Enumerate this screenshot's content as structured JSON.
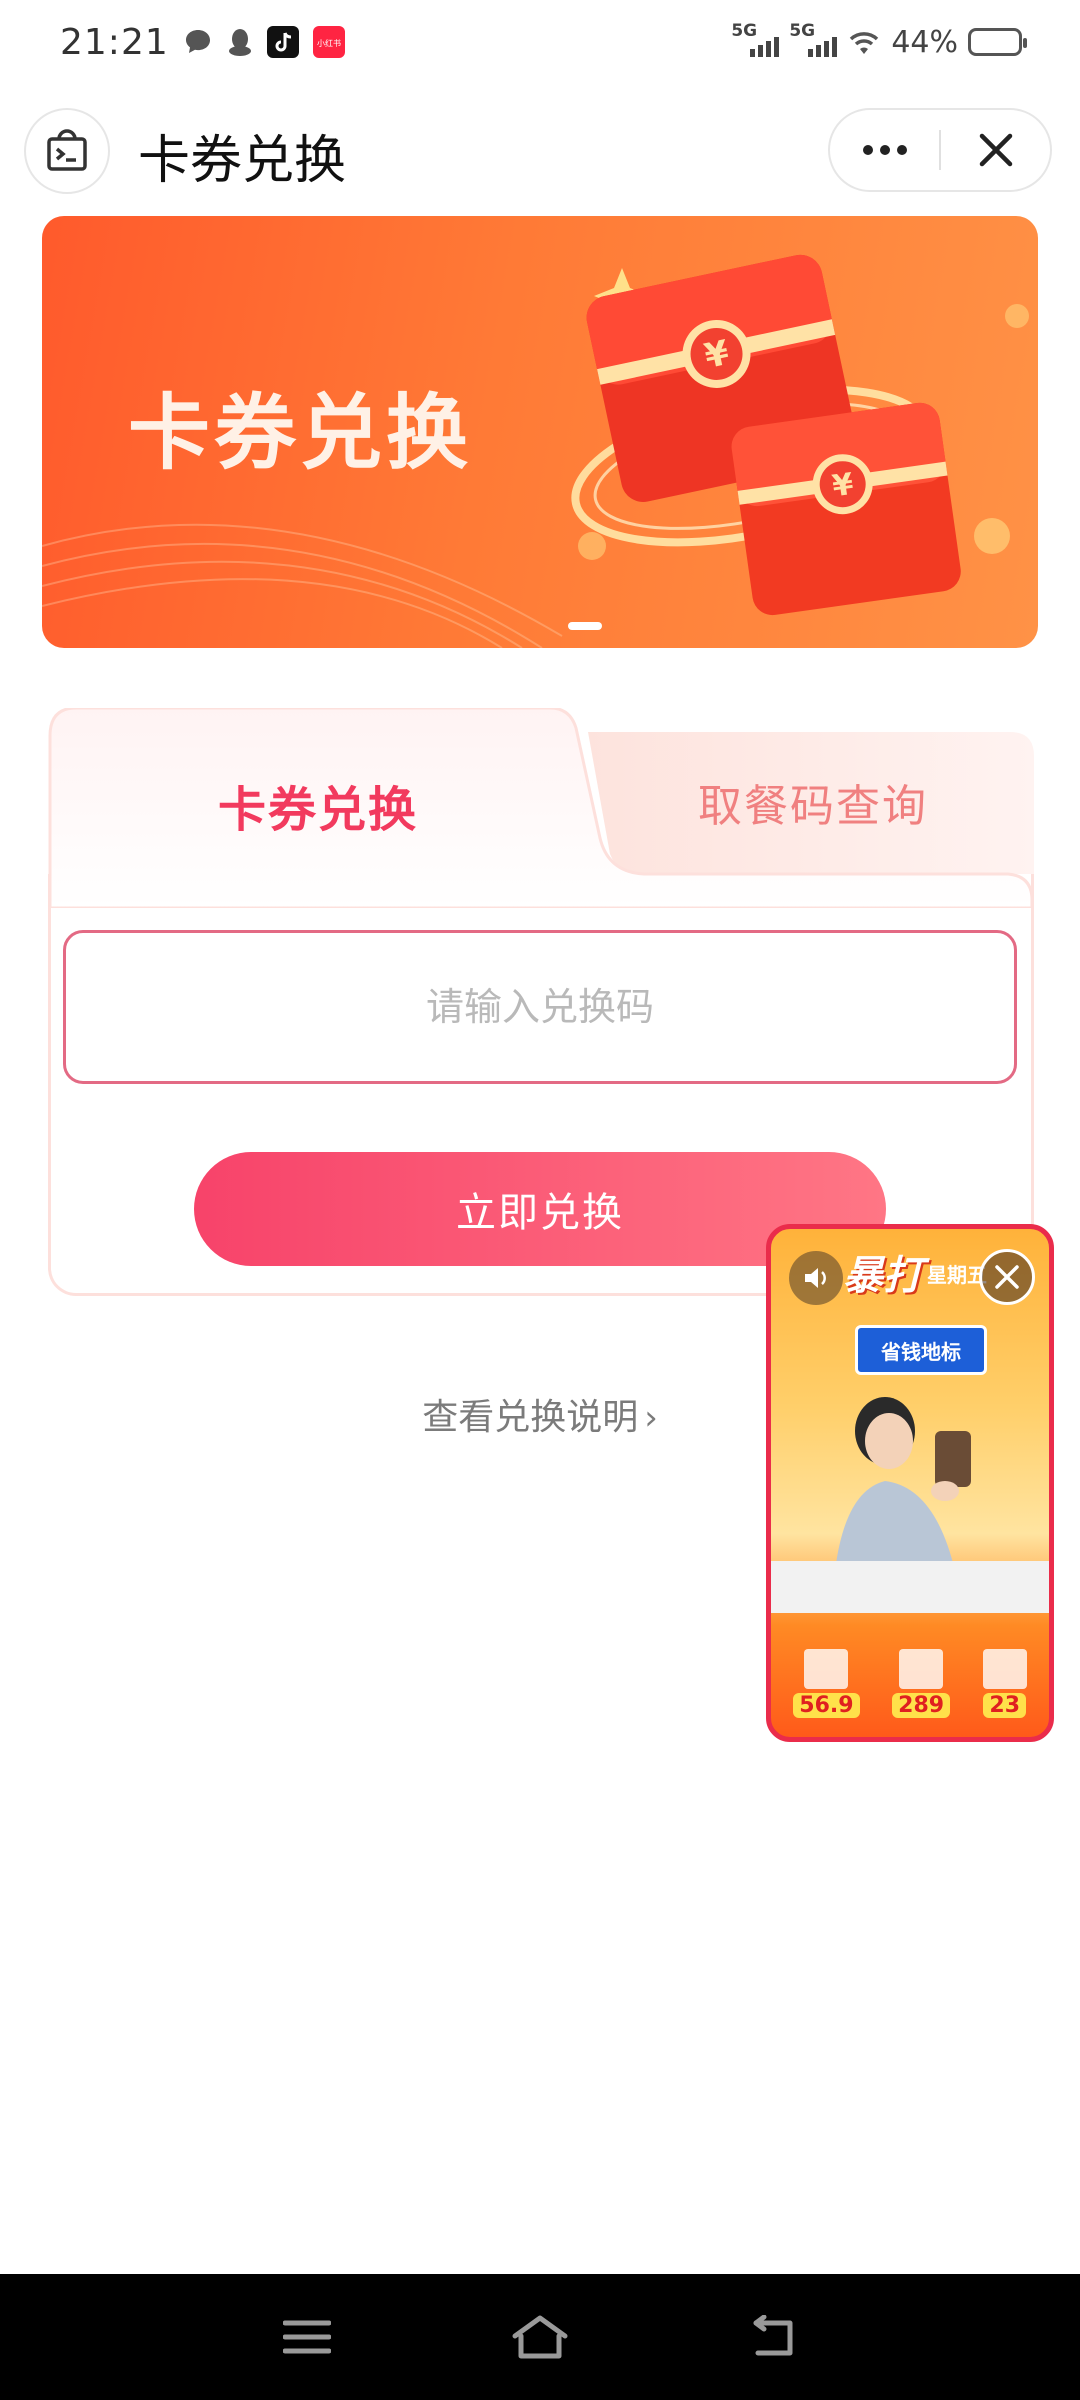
{
  "status_bar": {
    "time": "21:21",
    "network1": "5G",
    "network2": "5G",
    "battery": "44%",
    "battery_level": 0.44,
    "notification_icons": [
      "chat-bubble-icon",
      "qq-penguin-icon",
      "douyin-icon",
      "xiaohongshu-icon"
    ],
    "xiaohongshu_label": "小红书"
  },
  "header": {
    "title": "卡券兑换"
  },
  "banner": {
    "title": "卡券兑换",
    "currency_symbol": "¥"
  },
  "tabs": [
    {
      "label": "卡券兑换",
      "active": true
    },
    {
      "label": "取餐码查询",
      "active": false
    }
  ],
  "form": {
    "placeholder": "请输入兑换码",
    "value": "",
    "submit_label": "立即兑换"
  },
  "instructions_link": {
    "label": "查看兑换说明",
    "chevron": "›"
  },
  "live_overlay": {
    "title": "暴打",
    "subtitle": "星期五",
    "tag": "省钱地标",
    "prices": [
      "56.9",
      "289",
      "23"
    ]
  },
  "colors": {
    "accent": "#f23a5e",
    "banner_start": "#ff5a2c",
    "banner_end": "#ff9246",
    "button_start": "#f7436a",
    "button_end": "#ff7685",
    "input_border": "#e36a84"
  }
}
